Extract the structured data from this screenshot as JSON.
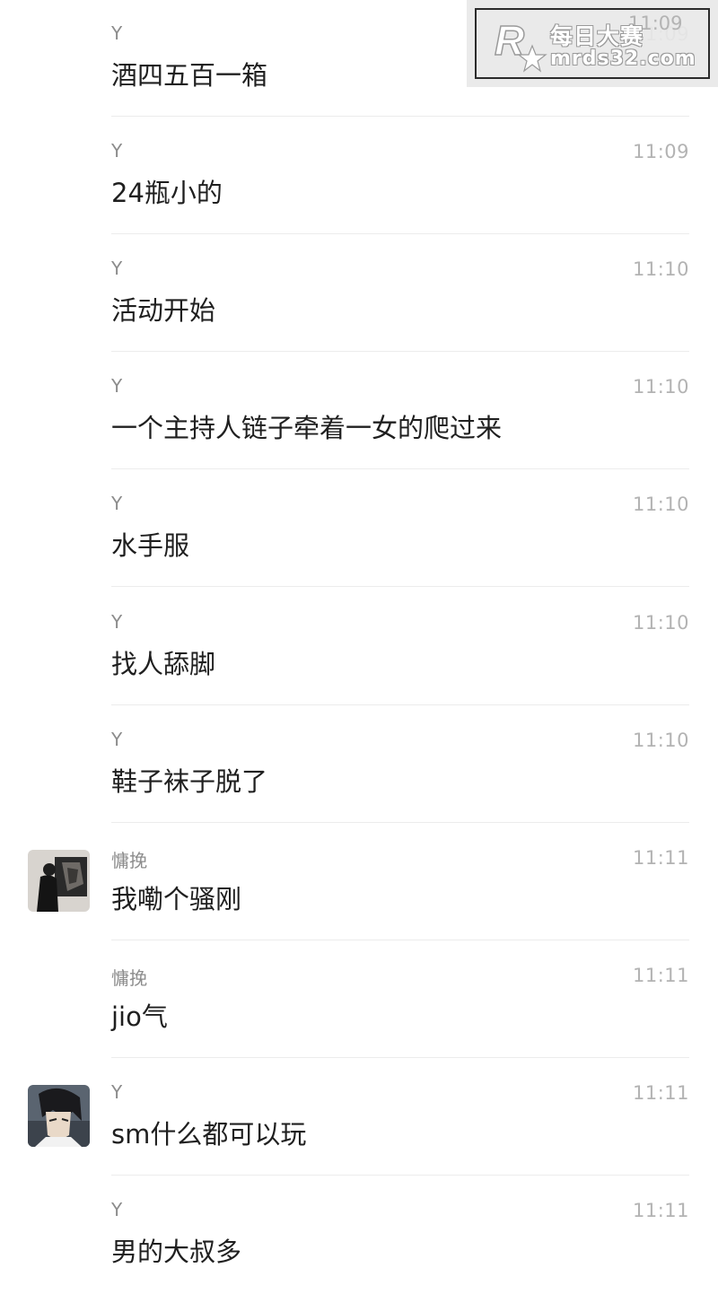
{
  "messages": [
    {
      "sender": "Y",
      "time": "11:09",
      "text": "酒四五百一箱"
    },
    {
      "sender": "Y",
      "time": "11:09",
      "text": "24瓶小的"
    },
    {
      "sender": "Y",
      "time": "11:10",
      "text": "活动开始"
    },
    {
      "sender": "Y",
      "time": "11:10",
      "text": "一个主持人链子牵着一女的爬过来"
    },
    {
      "sender": "Y",
      "time": "11:10",
      "text": "水手服"
    },
    {
      "sender": "Y",
      "time": "11:10",
      "text": "找人舔脚"
    },
    {
      "sender": "Y",
      "time": "11:10",
      "text": "鞋子袜子脱了"
    },
    {
      "sender": "慵挽",
      "time": "11:11",
      "text": "我嘞个骚刚"
    },
    {
      "sender": "慵挽",
      "time": "11:11",
      "text": "jio气"
    },
    {
      "sender": "Y",
      "time": "11:11",
      "text": "sm什么都可以玩"
    },
    {
      "sender": "Y",
      "time": "11:11",
      "text": "男的大叔多"
    }
  ],
  "watermark": {
    "title": "每日大赛",
    "url": "mrds32.com",
    "logo_letter": "R"
  },
  "colors": {
    "sender": "#8c8c8c",
    "time": "#b3b3b3",
    "text": "#1f1f1f",
    "divider": "#ececec"
  }
}
